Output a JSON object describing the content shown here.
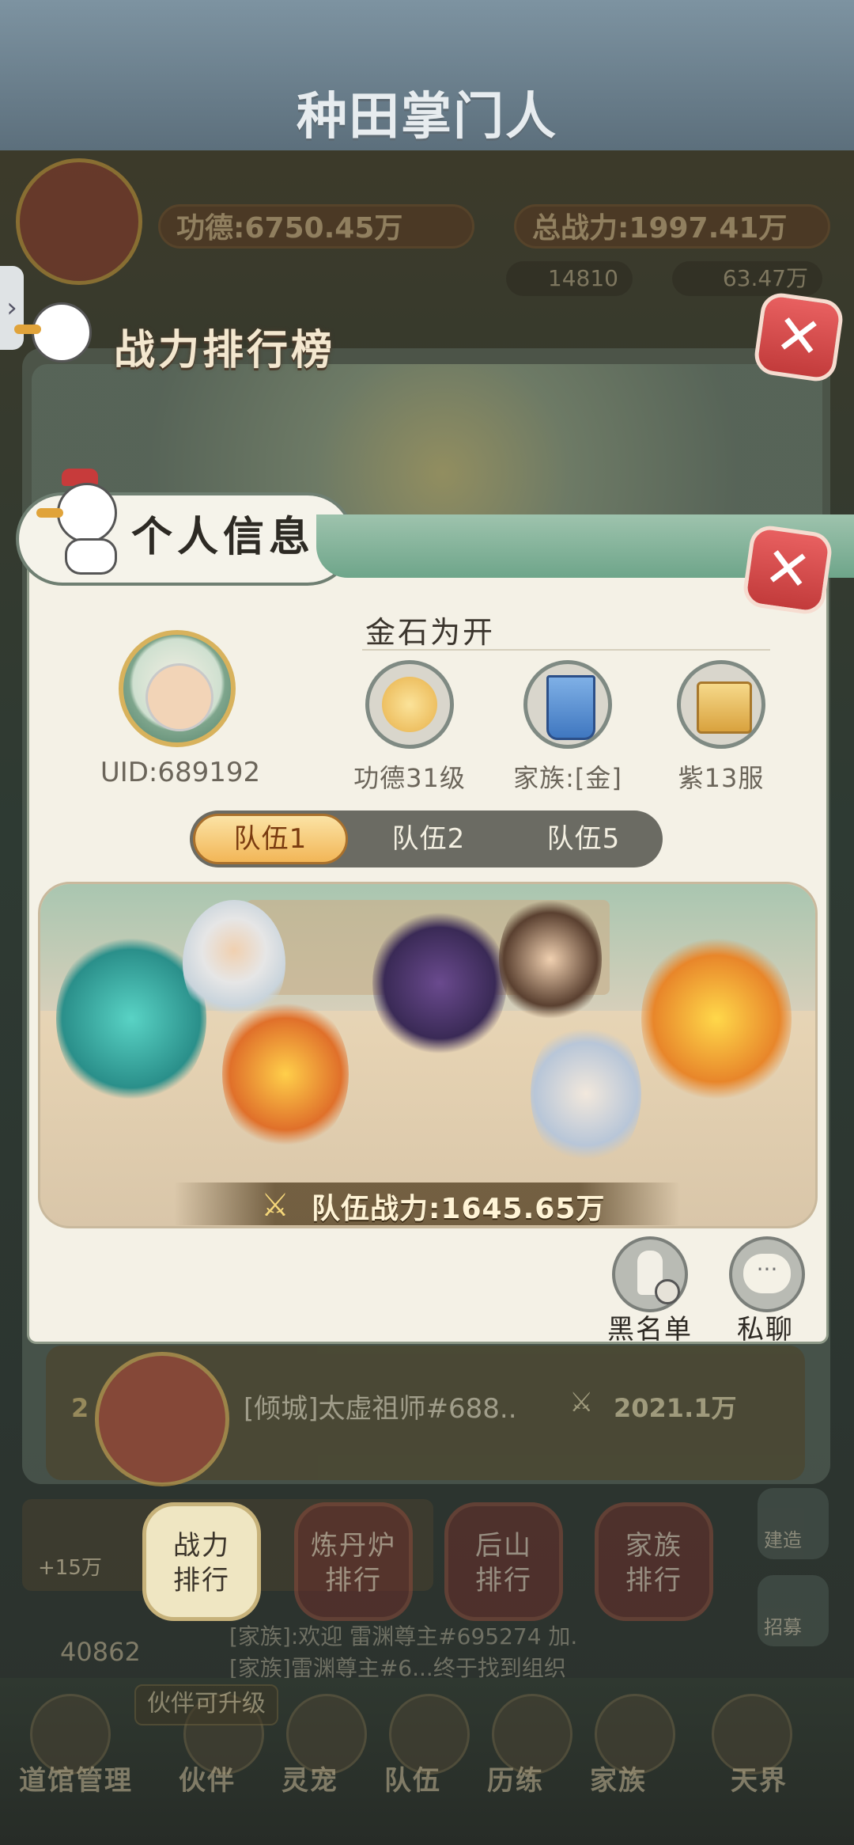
{
  "game_title": "种田掌门人",
  "top_stats": {
    "merit_label": "功德:",
    "merit_value": "6750.45万",
    "total_power_label": "总战力:",
    "total_power_value": "1997.41万",
    "currency_1": "14810",
    "currency_2": "63.47万"
  },
  "ranking_panel": {
    "title": "战力排行榜",
    "row": {
      "rank": "2",
      "name": "[倾城]太虚祖师#688..",
      "power": "2021.1万"
    }
  },
  "modal": {
    "title": "个人信息",
    "player_name": "金石为开",
    "uid": "UID:689192",
    "badges": [
      {
        "label": "功德31级",
        "icon": "lotus-icon"
      },
      {
        "label": "家族:[金]",
        "icon": "banner-icon"
      },
      {
        "label": "紫13服",
        "icon": "palace-icon"
      }
    ],
    "tabs": [
      "队伍1",
      "队伍2",
      "队伍5"
    ],
    "active_tab": "队伍1",
    "team_power": "队伍战力:1645.65万",
    "actions": [
      {
        "label": "黑名单",
        "icon": "blacklist-icon"
      },
      {
        "label": "私聊",
        "icon": "chat-bubble-icon"
      }
    ]
  },
  "ranking_tabs": [
    {
      "label": "战力\n排行",
      "active": true
    },
    {
      "label": "炼丹炉\n排行",
      "active": false
    },
    {
      "label": "后山\n排行",
      "active": false
    },
    {
      "label": "家族\n排行",
      "active": false
    }
  ],
  "left_bonus": "+15万",
  "right_side": [
    "建造",
    "招募"
  ],
  "chat": [
    "[家族]:欢迎  雷渊尊主#695274  加.",
    "[家族]雷渊尊主#6...终于找到组织"
  ],
  "bottom_counter": "40862",
  "tip": "伙伴可升级",
  "bottom_nav": [
    "道馆管理",
    "伙伴",
    "灵宠",
    "队伍",
    "历练",
    "家族",
    "天界"
  ],
  "colors": {
    "accent_gold": "#f2b657",
    "close_red": "#d94a4a",
    "modal_bg": "#f4f1e6"
  }
}
